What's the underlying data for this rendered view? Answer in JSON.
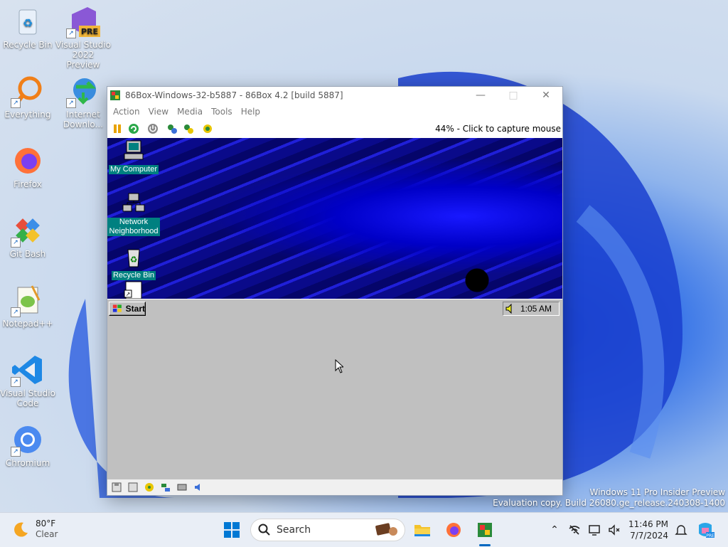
{
  "desktop": {
    "icons": [
      {
        "label": "Recycle Bin",
        "icon": "recycle-bin-icon"
      },
      {
        "label": "Visual Studio 2022 Preview",
        "badge": "PRE",
        "icon": "visual-studio-icon"
      },
      {
        "label": "Everything",
        "icon": "everything-search-icon"
      },
      {
        "label": "Internet Downlo...",
        "icon": "internet-download-manager-icon"
      },
      {
        "label": "Firefox",
        "icon": "firefox-icon"
      },
      {
        "label": "Git Bash",
        "icon": "git-bash-icon"
      },
      {
        "label": "Notepad++",
        "icon": "notepad-plus-plus-icon"
      },
      {
        "label": "Visual Studio Code",
        "icon": "vscode-icon"
      },
      {
        "label": "Chromium",
        "icon": "chromium-icon"
      }
    ]
  },
  "window": {
    "title": "86Box-Windows-32-b5887 - 86Box 4.2 [build 5887]",
    "menu": [
      "Action",
      "View",
      "Media",
      "Tools",
      "Help"
    ],
    "toolbar_status": "44% - Click to capture mouse",
    "toolbar_buttons": [
      "pause-icon",
      "reset-icon",
      "power-icon",
      "settings-icon",
      "cad-icon",
      "ctrl-alt-esc-icon"
    ],
    "statusbar_icons": [
      "floppy-icon",
      "floppy-b-icon",
      "cdrom-icon",
      "network-icon",
      "hdd-icon",
      "sound-icon"
    ]
  },
  "guest": {
    "icons": [
      {
        "label": "My Computer",
        "icon": "my-computer-icon"
      },
      {
        "label": "Network Neighborhood",
        "icon": "network-neighborhood-icon"
      },
      {
        "label": "Recycle Bin",
        "icon": "win95-recycle-bin-icon"
      }
    ],
    "start_label": "Start",
    "tray_time": "1:05 AM"
  },
  "watermark": {
    "line1": "Windows 11 Pro Insider Preview",
    "line2": "Evaluation copy. Build 26080.ge_release.240308-1400"
  },
  "taskbar": {
    "weather_temp": "80°F",
    "weather_cond": "Clear",
    "search_placeholder": "Search",
    "time": "11:46 PM",
    "date": "7/7/2024"
  },
  "colors": {
    "accent": "#0067c0",
    "win95_teal": "#008080",
    "win95_gray": "#c0c0c0"
  }
}
